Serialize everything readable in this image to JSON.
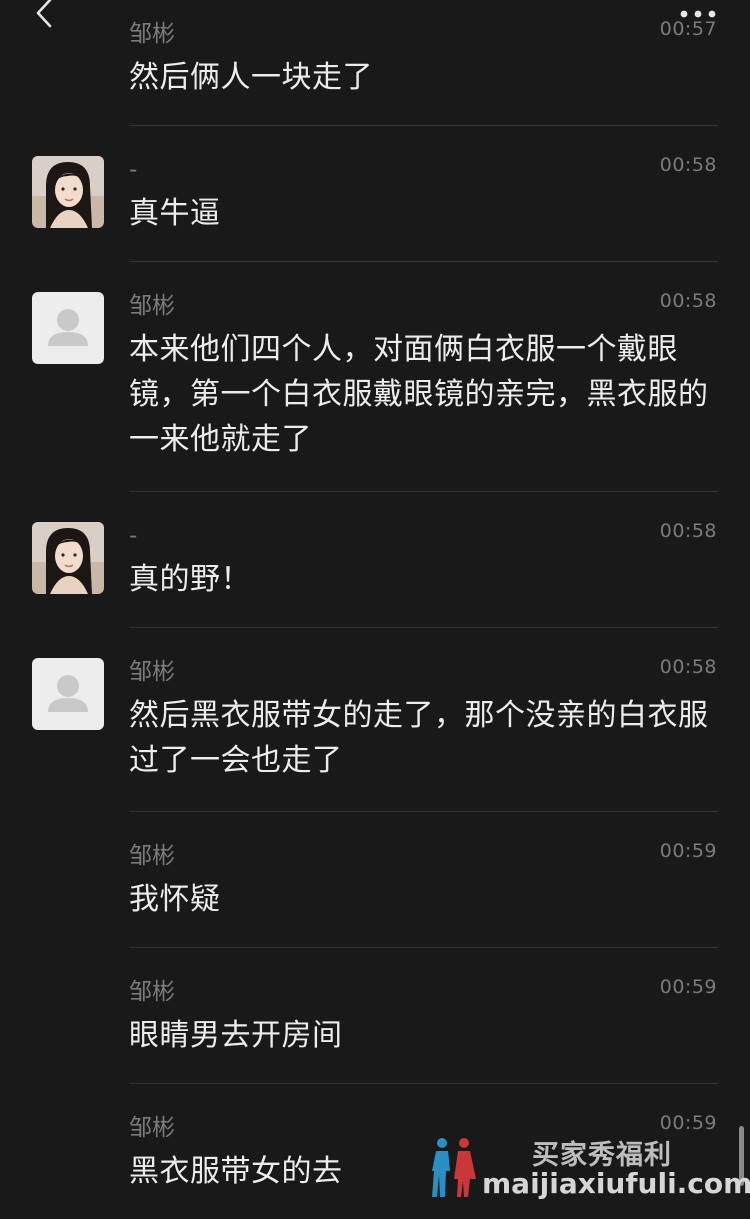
{
  "header": {
    "back_icon": "chevron-left-icon",
    "more_icon": "more-dots-icon"
  },
  "records": [
    {
      "sender": "邹彬",
      "time": "00:57",
      "text": "然后俩人一块走了",
      "avatar": "none"
    },
    {
      "sender": "-",
      "time": "00:58",
      "text": "真牛逼",
      "avatar": "girl-photo"
    },
    {
      "sender": "邹彬",
      "time": "00:58",
      "text": "本来他们四个人，对面俩白衣服一个戴眼镜，第一个白衣服戴眼镜的亲完，黑衣服的一来他就走了",
      "avatar": "default-user"
    },
    {
      "sender": "-",
      "time": "00:58",
      "text": "真的野！",
      "avatar": "girl-photo"
    },
    {
      "sender": "邹彬",
      "time": "00:58",
      "text": "然后黑衣服带女的走了，那个没亲的白衣服过了一会也走了",
      "avatar": "default-user"
    },
    {
      "sender": "邹彬",
      "time": "00:59",
      "text": "我怀疑",
      "avatar": "none"
    },
    {
      "sender": "邹彬",
      "time": "00:59",
      "text": "眼睛男去开房间",
      "avatar": "none"
    },
    {
      "sender": "邹彬",
      "time": "00:59",
      "text": "黑衣服带女的去",
      "avatar": "none"
    }
  ],
  "watermark": {
    "cn": "买家秀福利",
    "en": "maijiaxiufuli.com"
  },
  "colors": {
    "background": "#191919",
    "text": "#ececec",
    "meta": "#7a7a7a",
    "divider": "#333333"
  }
}
